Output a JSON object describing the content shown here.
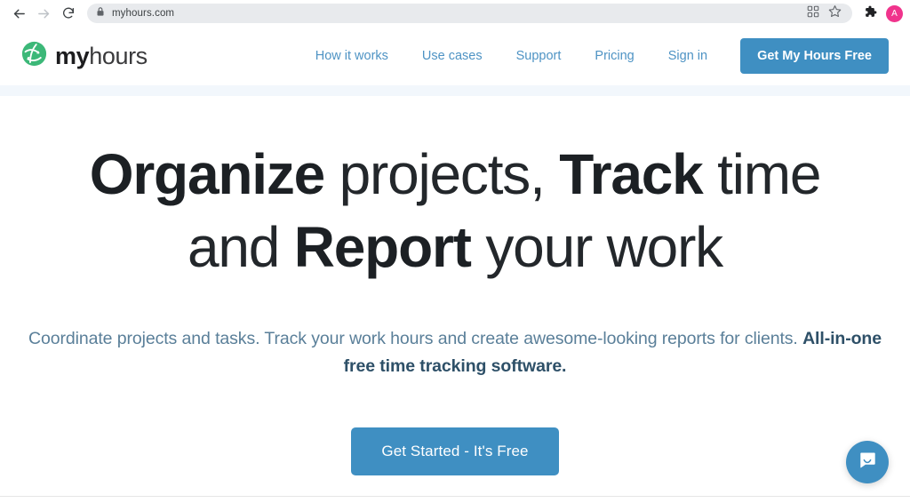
{
  "browser": {
    "back_icon": "arrow-left-icon",
    "forward_icon": "arrow-right-icon",
    "reload_icon": "reload-icon",
    "lock_icon": "lock-icon",
    "url": "myhours.com",
    "qr_icon": "qr-code-icon",
    "bookmark_icon": "star-icon",
    "extensions_icon": "puzzle-piece-icon",
    "avatar_label": "A",
    "avatar_color": "#f0338c"
  },
  "header": {
    "logo_icon": "myhours-globe-icon",
    "brand_primary": "my",
    "brand_secondary": "hours",
    "nav": [
      {
        "label": "How it works"
      },
      {
        "label": "Use cases"
      },
      {
        "label": "Support"
      },
      {
        "label": "Pricing"
      },
      {
        "label": "Sign in"
      }
    ],
    "cta_label": "Get My Hours Free",
    "accent_color": "#3f8fc2"
  },
  "hero": {
    "title_line1_a": "Organize",
    "title_line1_b": " projects, ",
    "title_line1_c": "Track",
    "title_line1_d": " time",
    "title_line2_a": "and ",
    "title_line2_b": "Report",
    "title_line2_c": " your work",
    "sub_regular": "Coordinate projects and tasks. Track your work hours and create awesome-looking reports for clients. ",
    "sub_bold": "All-in-one free time tracking software.",
    "cta_label": "Get Started - It's Free",
    "chat_icon": "chat-bubble-icon"
  }
}
